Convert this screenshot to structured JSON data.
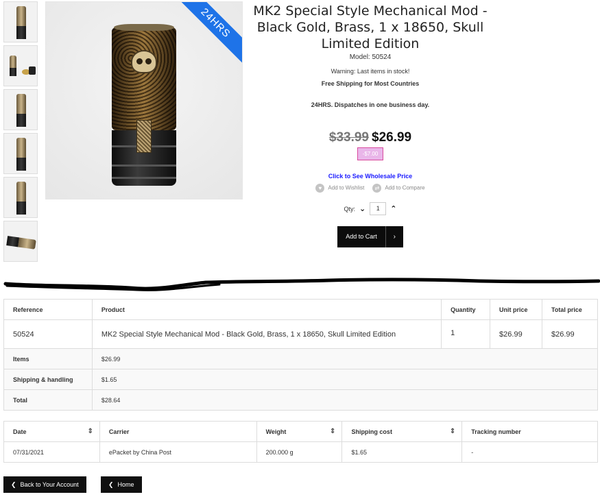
{
  "gallery": {
    "badge": "24HRS",
    "thumbnails": [
      "thumb-1",
      "thumb-2",
      "thumb-3",
      "thumb-4",
      "thumb-5",
      "thumb-6"
    ]
  },
  "product": {
    "title": "MK2 Special Style Mechanical Mod - Black Gold, Brass, 1 x 18650, Skull Limited Edition",
    "model_label": "Model:",
    "model_value": "50524",
    "warning": "Warning: Last items in stock!",
    "shipping_note": "Free Shipping for Most Countries",
    "dispatch_note": "24HRS. Dispatches in one business day.",
    "old_price": "$33.99",
    "price": "$26.99",
    "discount": "-$7.00",
    "wholesale_link": "Click to See Wholesale Price",
    "wishlist_label": "Add to Wishlist",
    "compare_label": "Add to Compare",
    "qty_label": "Qty:",
    "qty_value": "1",
    "add_to_cart": "Add to Cart"
  },
  "order_table": {
    "headers": [
      "Reference",
      "Product",
      "Quantity",
      "Unit price",
      "Total price"
    ],
    "row": {
      "reference": "50524",
      "product": "MK2 Special Style Mechanical Mod - Black Gold, Brass, 1 x 18650, Skull Limited Edition",
      "quantity": "1",
      "unit_price": "$26.99",
      "total_price": "$26.99"
    },
    "summary": [
      {
        "label": "Items",
        "value": "$26.99"
      },
      {
        "label": "Shipping & handling",
        "value": "$1.65"
      },
      {
        "label": "Total",
        "value": "$28.64"
      }
    ]
  },
  "shipping_table": {
    "headers": [
      "Date",
      "Carrier",
      "Weight",
      "Shipping cost",
      "Tracking number"
    ],
    "row": {
      "date": "07/31/2021",
      "carrier": "ePacket by China Post",
      "weight": "200.000 g",
      "shipping_cost": "$1.65",
      "tracking_number": "-"
    }
  },
  "buttons": {
    "back": "Back to Your Account",
    "home": "Home"
  }
}
